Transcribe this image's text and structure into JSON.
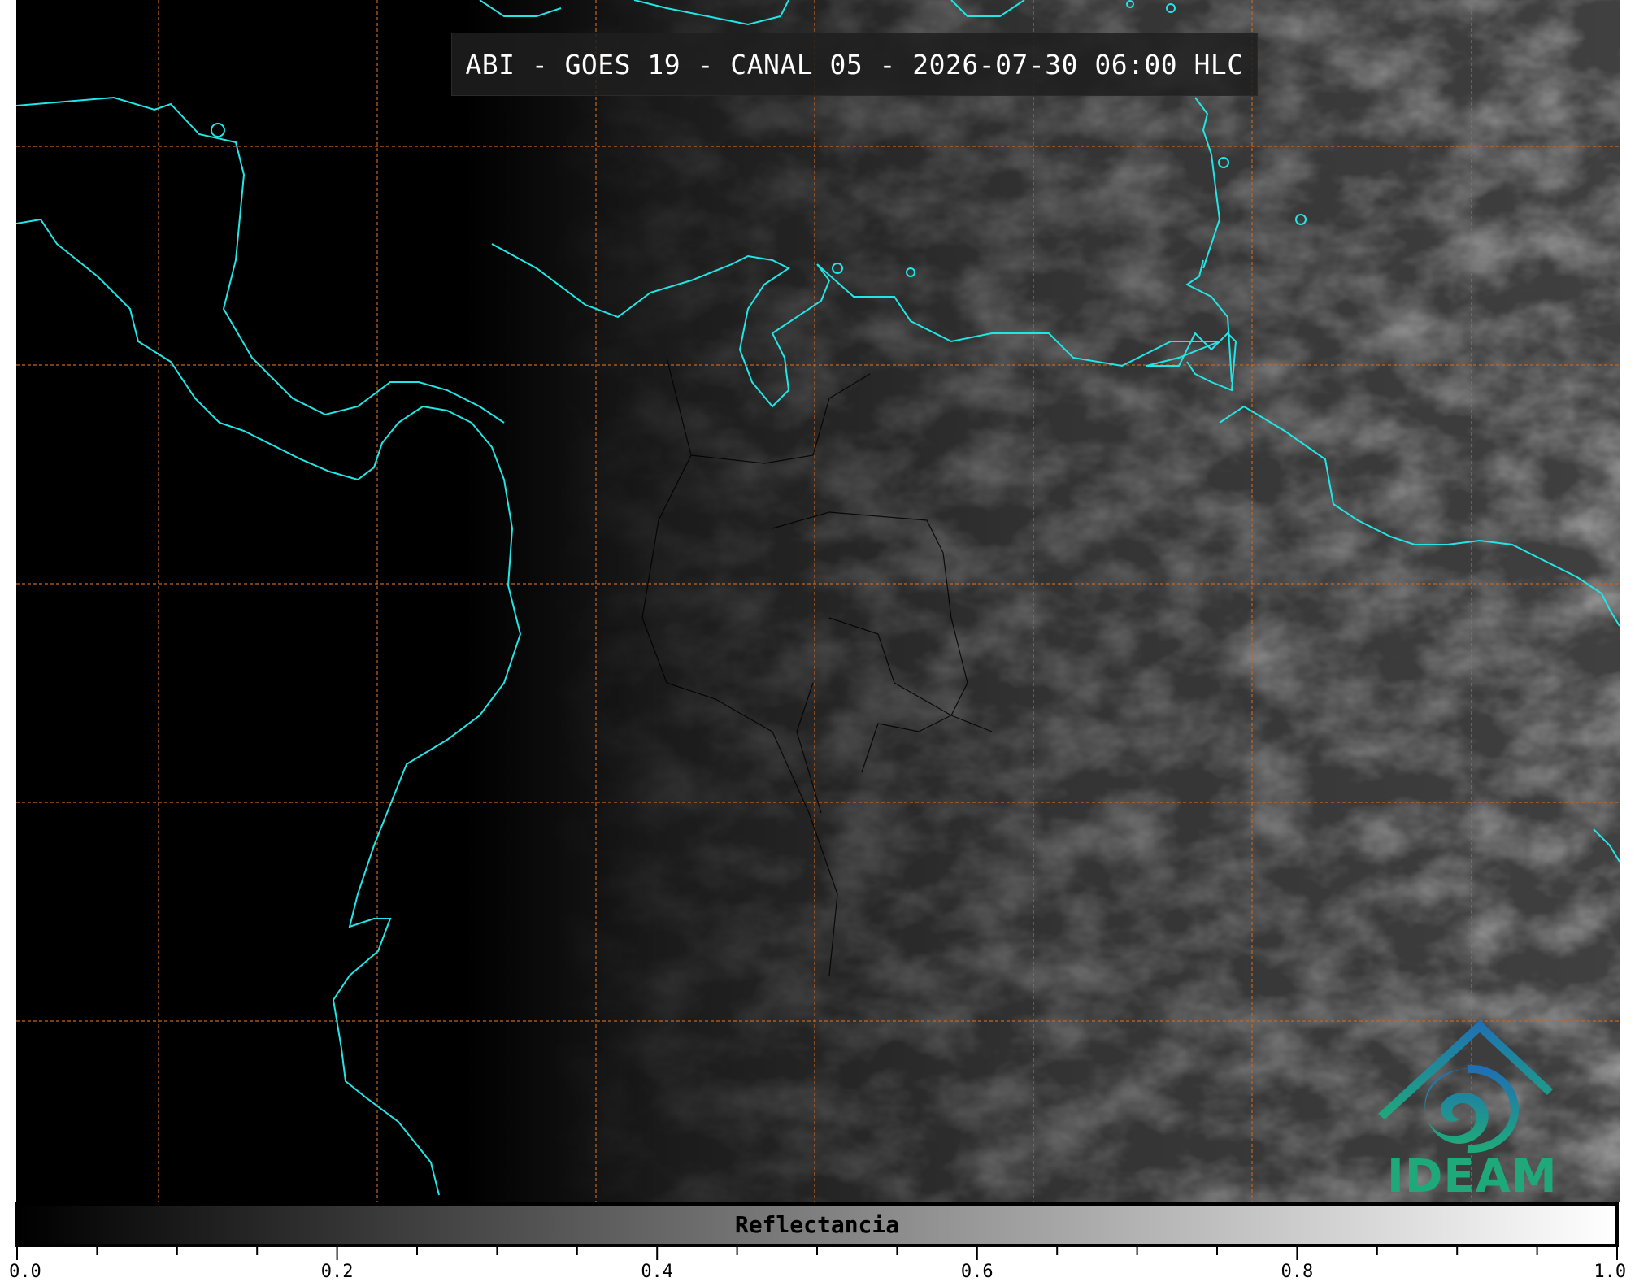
{
  "title": "ABI - GOES 19 - CANAL 05 - 2026-07-30 06:00 HLC",
  "colorbar": {
    "label": "Reflectancia",
    "min": 0.0,
    "max": 1.0,
    "major_ticks": [
      "0.0",
      "0.2",
      "0.4",
      "0.6",
      "0.8",
      "1.0"
    ],
    "minor_tick_count_between_majors": 3
  },
  "logo": {
    "text": "IDEAM",
    "colors": [
      "#1f6fb5",
      "#1fa97a"
    ]
  },
  "colors": {
    "coastline": "#22e5e5",
    "gridline": "#c8641e",
    "borders": "#000000",
    "background": "#000000"
  }
}
